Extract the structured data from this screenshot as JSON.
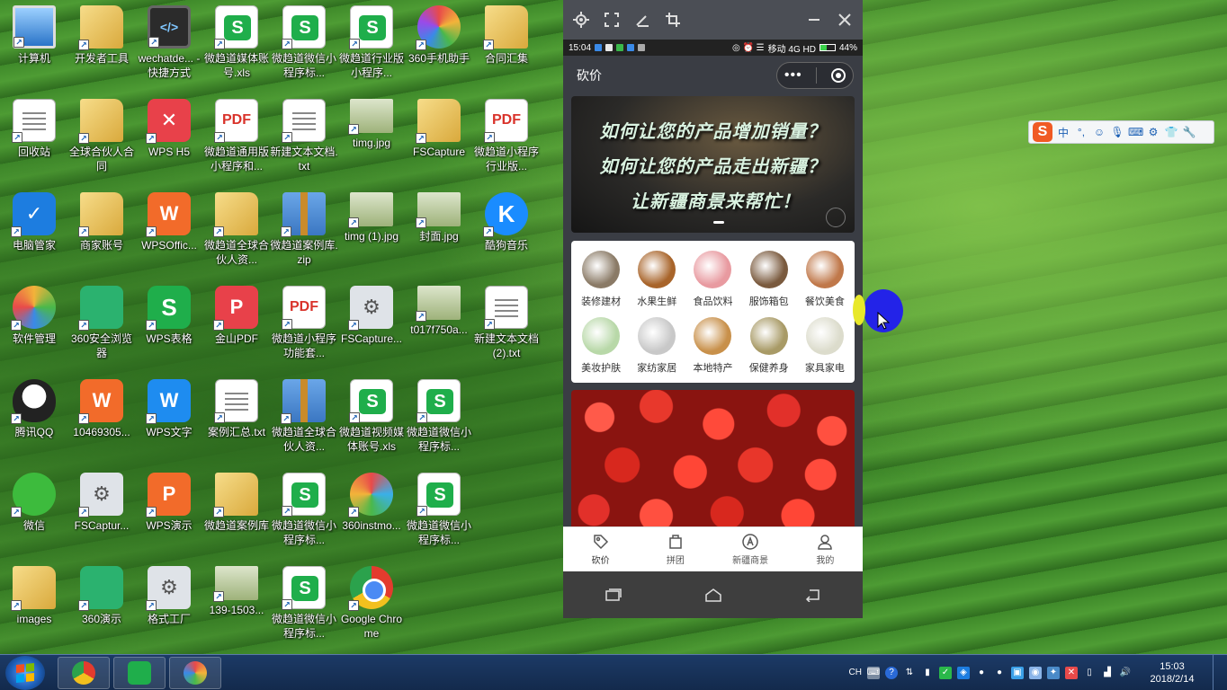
{
  "desktop": {
    "icons": [
      {
        "label": "计算机",
        "icon": "computer-icon"
      },
      {
        "label": "开发者工具",
        "icon": "folder-icon"
      },
      {
        "label": "wechatde... - 快捷方式",
        "icon": "code-editor-icon"
      },
      {
        "label": "微趋道媒体账号.xls",
        "icon": "wps-spreadsheet-icon"
      },
      {
        "label": "微趋道微信小程序标...",
        "icon": "wps-spreadsheet-icon"
      },
      {
        "label": "微趋道行业版小程序...",
        "icon": "wps-spreadsheet-icon"
      },
      {
        "label": "360手机助手",
        "icon": "360-phone-assistant-icon"
      },
      {
        "label": "合同汇集",
        "icon": "folder-icon"
      },
      {
        "label": "回收站",
        "icon": "recycle-bin-icon"
      },
      {
        "label": "全球合伙人合同",
        "icon": "folder-icon"
      },
      {
        "label": "WPS H5",
        "icon": "wps-h5-icon"
      },
      {
        "label": "微趋道通用版小程序和...",
        "icon": "pdf-icon"
      },
      {
        "label": "新建文本文档.txt",
        "icon": "text-file-icon"
      },
      {
        "label": "timg.jpg",
        "icon": "image-icon"
      },
      {
        "label": "FSCapture",
        "icon": "folder-icon"
      },
      {
        "label": "微趋道小程序行业版...",
        "icon": "pdf-icon"
      },
      {
        "label": "电脑管家",
        "icon": "pc-manager-icon"
      },
      {
        "label": "商家账号",
        "icon": "folder-icon"
      },
      {
        "label": "WPSOffic...",
        "icon": "wps-office-icon"
      },
      {
        "label": "微趋道全球合伙人资...",
        "icon": "folder-icon"
      },
      {
        "label": "微趋道案例库.zip",
        "icon": "zip-icon"
      },
      {
        "label": "timg (1).jpg",
        "icon": "image-icon"
      },
      {
        "label": "封面.jpg",
        "icon": "image-icon"
      },
      {
        "label": "酷狗音乐",
        "icon": "kugou-music-icon"
      },
      {
        "label": "软件管理",
        "icon": "software-manager-icon"
      },
      {
        "label": "360安全浏览器",
        "icon": "360-browser-icon"
      },
      {
        "label": "WPS表格",
        "icon": "wps-spreadsheet-app-icon"
      },
      {
        "label": "金山PDF",
        "icon": "kingsoft-pdf-icon"
      },
      {
        "label": "微趋道小程序功能套...",
        "icon": "pdf-icon"
      },
      {
        "label": "FSCapture...",
        "icon": "fscapture-icon"
      },
      {
        "label": "t017f750a...",
        "icon": "image-icon"
      },
      {
        "label": "新建文本文档 (2).txt",
        "icon": "text-file-icon"
      },
      {
        "label": "腾讯QQ",
        "icon": "qq-icon"
      },
      {
        "label": "10469305...",
        "icon": "wps-office-icon"
      },
      {
        "label": "WPS文字",
        "icon": "wps-writer-icon"
      },
      {
        "label": "案例汇总.txt",
        "icon": "text-file-icon"
      },
      {
        "label": "微趋道全球合伙人资...",
        "icon": "zip-icon"
      },
      {
        "label": "微趋道视频媒体账号.xls",
        "icon": "wps-spreadsheet-icon"
      },
      {
        "label": "微趋道微信小程序标...",
        "icon": "wps-spreadsheet-icon"
      },
      {
        "label": "微信",
        "icon": "wechat-icon"
      },
      {
        "label": "FSCaptur...",
        "icon": "fscapture-icon"
      },
      {
        "label": "WPS演示",
        "icon": "wps-presentation-icon"
      },
      {
        "label": "微趋道案例库",
        "icon": "folder-icon"
      },
      {
        "label": "微趋道微信小程序标...",
        "icon": "wps-spreadsheet-icon"
      },
      {
        "label": "360instmo...",
        "icon": "360-installer-icon"
      },
      {
        "label": "微趋道微信小程序标...",
        "icon": "wps-spreadsheet-icon"
      },
      {
        "label": "images",
        "icon": "folder-icon"
      },
      {
        "label": "360演示",
        "icon": "360-presentation-icon"
      },
      {
        "label": "格式工厂",
        "icon": "format-factory-icon"
      },
      {
        "label": "139-1503...",
        "icon": "image-icon"
      },
      {
        "label": "微趋道微信小程序标...",
        "icon": "wps-spreadsheet-icon"
      },
      {
        "label": "Google Chrome",
        "icon": "chrome-icon"
      }
    ]
  },
  "phone": {
    "status": {
      "time": "15:04",
      "carrier": "移动 4G HD",
      "battery": "44%"
    },
    "nav": {
      "title": "砍价",
      "more": "•••"
    },
    "banner": {
      "lines": [
        "如何让您的产品增加销量？",
        "如何让您的产品走出新疆？",
        "让新疆商景来帮忙！"
      ]
    },
    "categories": [
      {
        "label": "装修建材",
        "color": "#8a7a66"
      },
      {
        "label": "水果生鲜",
        "color": "#a8642a"
      },
      {
        "label": "食品饮料",
        "color": "#e89aa0"
      },
      {
        "label": "服饰箱包",
        "color": "#7a5a3e"
      },
      {
        "label": "餐饮美食",
        "color": "#c0784a"
      },
      {
        "label": "美妆护肤",
        "color": "#b8d8a8"
      },
      {
        "label": "家纺家居",
        "color": "#c8c8c8"
      },
      {
        "label": "本地特产",
        "color": "#c8904a"
      },
      {
        "label": "保健养身",
        "color": "#a89a66"
      },
      {
        "label": "家具家电",
        "color": "#dcdccc"
      }
    ],
    "tabs": [
      {
        "label": "砍价",
        "icon": "price-tag-icon"
      },
      {
        "label": "拼团",
        "icon": "group-buy-icon"
      },
      {
        "label": "新疆商景",
        "icon": "store-icon"
      },
      {
        "label": "我的",
        "icon": "user-icon"
      }
    ]
  },
  "ime": {
    "logo": "S",
    "mode": "中"
  },
  "taskbar": {
    "tray_lang": "CH",
    "time": "15:03",
    "date": "2018/2/14"
  }
}
